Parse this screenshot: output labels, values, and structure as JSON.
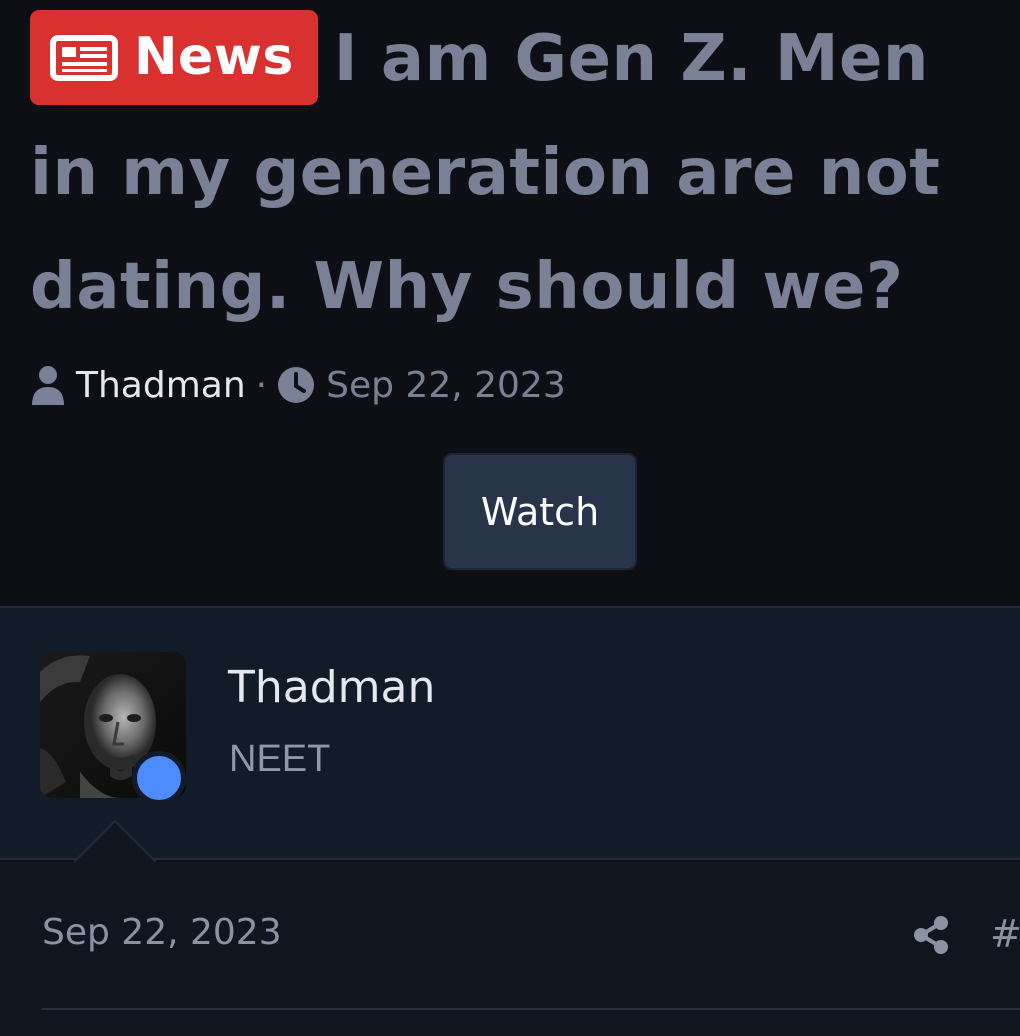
{
  "thread": {
    "prefix_label": "News",
    "prefix_color": "#d93030",
    "prefix_icon": "newspaper-icon",
    "title": "I am Gen Z. Men in my generation are not dating. Why should we?",
    "author": "Thadman",
    "separator": "·",
    "date": "Sep 22, 2023",
    "watch_label": "Watch"
  },
  "post": {
    "username": "Thadman",
    "user_title": "NEET",
    "online_status_color": "#4d8cff",
    "date": "Sep 22, 2023",
    "permalink_label": "#"
  },
  "icons": {
    "author": "user-icon",
    "date": "clock-icon",
    "share": "share-icon"
  }
}
